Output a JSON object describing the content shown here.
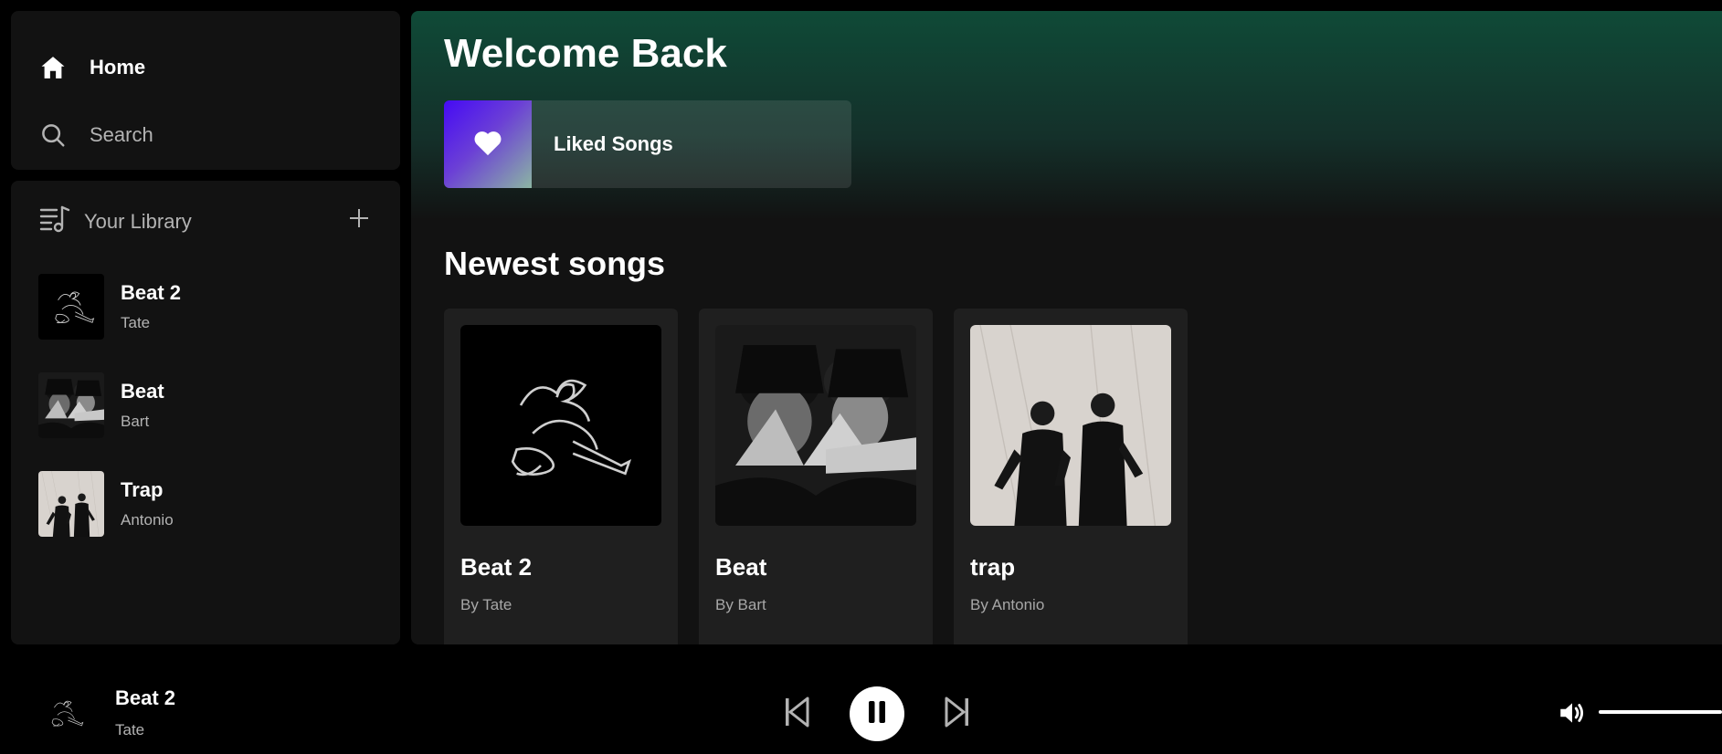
{
  "nav": {
    "home_label": "Home",
    "search_label": "Search"
  },
  "library": {
    "title": "Your Library",
    "items": [
      {
        "title": "Beat 2",
        "artist": "Tate"
      },
      {
        "title": "Beat",
        "artist": "Bart"
      },
      {
        "title": "Trap",
        "artist": "Antonio"
      }
    ]
  },
  "main": {
    "greeting": "Welcome Back",
    "liked_songs_label": "Liked Songs",
    "section_title": "Newest songs",
    "cards": [
      {
        "title": "Beat 2",
        "subtitle": "By Tate"
      },
      {
        "title": "Beat",
        "subtitle": "By Bart"
      },
      {
        "title": "trap",
        "subtitle": "By Antonio"
      }
    ]
  },
  "player": {
    "now_playing_title": "Beat 2",
    "now_playing_artist": "Tate",
    "is_playing": true,
    "volume": 1.0
  },
  "colors": {
    "background": "#000000",
    "panel": "#121212",
    "card": "#1f1f1f",
    "header_gradient": "#0f4a37",
    "liked_gradient_start": "#450af5",
    "text_secondary": "#b3b3b3"
  },
  "icons": {
    "home": "home-icon",
    "search": "search-icon",
    "library": "library-icon",
    "add": "plus-icon",
    "liked": "heart-icon",
    "prev": "skip-back-icon",
    "play_state": "pause-icon",
    "next": "skip-forward-icon",
    "volume": "volume-icon"
  }
}
